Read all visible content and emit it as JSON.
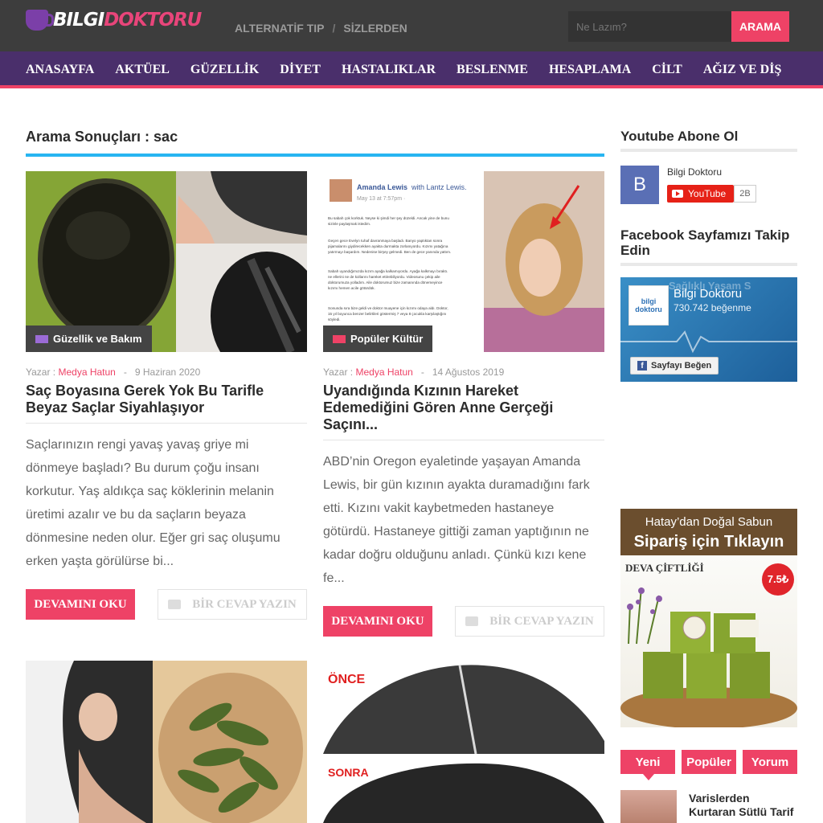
{
  "header": {
    "logo_part1": "BILGI",
    "logo_part2": "DOKTORU",
    "top_links": [
      "ALTERNATİF TIP",
      "SİZLERDEN"
    ],
    "top_link_separator": "/",
    "search_placeholder": "Ne Lazım?",
    "search_button": "ARAMA"
  },
  "nav": {
    "items": [
      "ANASAYFA",
      "AKTÜEL",
      "GÜZELLİK",
      "DİYET",
      "HASTALIKLAR",
      "BESLENME",
      "HESAPLAMA",
      "CİLT",
      "AĞIZ VE DİŞ"
    ]
  },
  "main": {
    "heading": "Arama Sonuçları : sac",
    "author_prefix": "Yazar :",
    "date_sep": "-",
    "more_label": "DEVAMINI OKU",
    "reply_label": "BİR CEVAP YAZIN",
    "posts": [
      {
        "category": "Güzellik ve Bakım",
        "category_color": "#9b6bd6",
        "author": "Medya Hatun",
        "date": "9 Haziran 2020",
        "title": "Saç Boyasına Gerek Yok Bu Tarifle Beyaz Saçlar Siyahlaşıyor",
        "excerpt": "Saçlarınızın rengi yavaş yavaş griye mi dönmeye başladı? Bu durum çoğu insanı korkutur. Yaş aldıkça saç köklerinin melanin üretimi azalır ve bu da saçların beyaza dönmesine neden olur. Eğer gri saç oluşumu erken yaşta görülürse bi..."
      },
      {
        "category": "Popüler Kültür",
        "category_color": "#ee4266",
        "author": "Medya Hatun",
        "date": "14 Ağustos 2019",
        "title": "Uyandığında Kızının Hareket Edemediğini Gören Anne Gerçeği Saçını...",
        "excerpt": "ABD’nin Oregon eyaletinde yaşayan Amanda Lewis, bir gün kızının ayakta duramadığını fark etti. Kızını vakit kaybetmeden hastaneye götürdü. Hastaneye gittiği zaman yaptığının ne kadar doğru olduğunu anladı. Çünkü kızı kene fe...",
        "screenshot_name": "Amanda Lewis",
        "screenshot_with": "with Lantz Lewis.",
        "screenshot_date": "May 13 at 7:57pm · ",
        "screenshot_lines": [
          "Bu sabah çok korktuk. Neyse ki şimdi her şey düzeldi. Ancak yine de bunu",
          "sizinle paylaşmak istedim.",
          "Geçen gece Evelyn tuhaf davranmaya başladı. Banyo yaptıktan sonra",
          "pijamalarını giydirecekken ayakta durmakta zorlanıyordu. Kızımı yatağına",
          "yatırmayı başardım. Nedenise birşey gelmedi. Ben de gece yanında yattım.",
          "Sabah uyandığımızda kızım ayağa kalkamıyordu. Ayağa kalkmayı bıraktı.",
          "ne ellerini ne de kollarını hareket ettirebiliyordu. Videosunu çekip aile",
          "doktorumuza yolladım. Aile doktorumuz bize zamanında dönemeyince",
          "kızımı hemen acile götürdük.",
          "Sonunda sıra bize geldi ve doktor muayene için kızımı odaya aldı. Doktor,",
          "15 yıl boyunca benzer belirtileri göstermiş 7 veya 8 çocukla karşılaştığını",
          "söyledi."
        ]
      },
      {
        "overlay_before": "ÖNCE",
        "overlay_after": "SONRA"
      }
    ]
  },
  "sidebar": {
    "youtube_title": "Youtube Abone Ol",
    "youtube_avatar_letter": "B",
    "youtube_channel": "Bilgi Doktoru",
    "youtube_button": "YouTube",
    "youtube_count": "2B",
    "facebook_title": "Facebook Sayfamızı Takip Edin",
    "facebook_page_name": "Bilgi Doktoru",
    "facebook_likes": "730.742 beğenme",
    "facebook_like_button": "Sayfayı Beğen",
    "facebook_logo_text": "bilgi doktoru",
    "facebook_banner_text": "Sağlıklı Yaşam S",
    "ad_line1": "Hatay’dan Doğal Sabun",
    "ad_line2": "Sipariş için Tıklayın",
    "ad_brand": "DEVA ÇİFTLİĞİ",
    "ad_price": "7.5₺",
    "tabs": [
      "Yeni",
      "Popüler",
      "Yorum"
    ],
    "tab_item_title": "Varislerden Kurtaran Sütlü Tarif"
  },
  "colors": {
    "accent": "#ee4266",
    "nav_bg": "#4a2f6b",
    "topbar_bg": "#3d3d3d",
    "heading_underline": "#28b5f1"
  }
}
